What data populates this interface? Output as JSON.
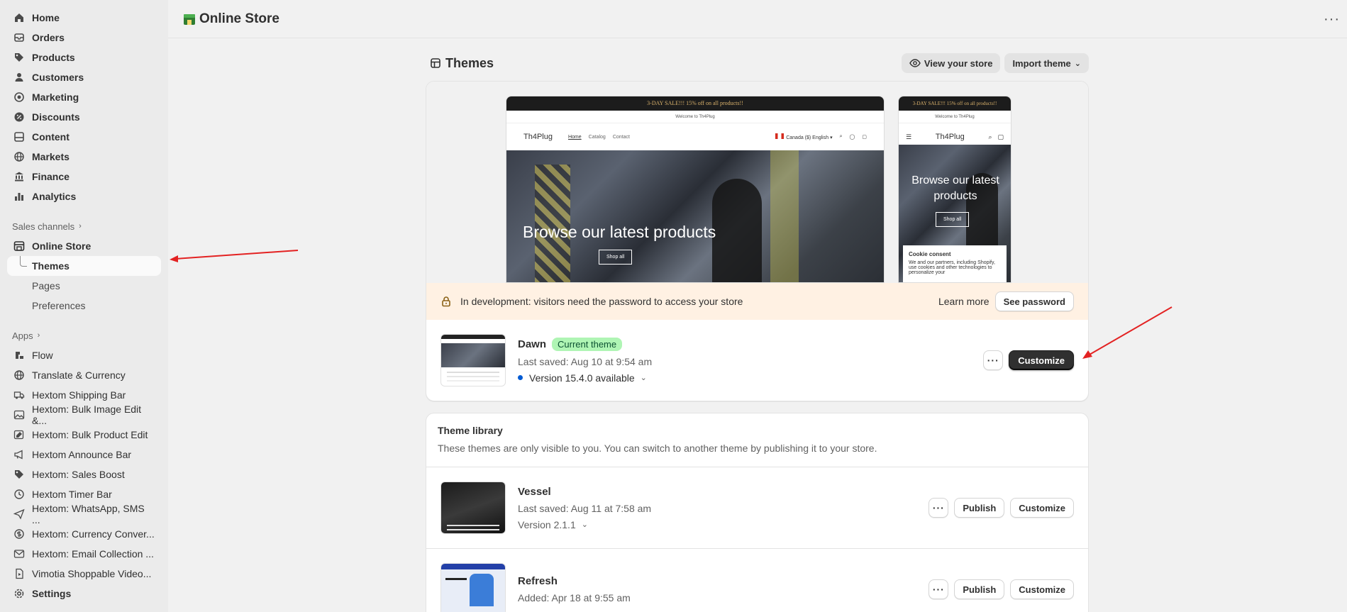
{
  "sidebar": {
    "main_items": [
      {
        "label": "Home",
        "icon": "home-icon"
      },
      {
        "label": "Orders",
        "icon": "orders-icon"
      },
      {
        "label": "Products",
        "icon": "tag-icon"
      },
      {
        "label": "Customers",
        "icon": "person-icon"
      },
      {
        "label": "Marketing",
        "icon": "target-icon"
      },
      {
        "label": "Discounts",
        "icon": "discount-icon"
      },
      {
        "label": "Content",
        "icon": "content-icon"
      },
      {
        "label": "Markets",
        "icon": "globe-icon"
      },
      {
        "label": "Finance",
        "icon": "bank-icon"
      },
      {
        "label": "Analytics",
        "icon": "chart-icon"
      }
    ],
    "sales_channels_label": "Sales channels",
    "online_store_label": "Online Store",
    "online_store_sub": [
      "Themes",
      "Pages",
      "Preferences"
    ],
    "apps_label": "Apps",
    "apps": [
      {
        "label": "Flow",
        "icon": "flow-icon"
      },
      {
        "label": "Translate & Currency",
        "icon": "globe-icon"
      },
      {
        "label": "Hextom Shipping Bar",
        "icon": "truck-icon"
      },
      {
        "label": "Hextom: Bulk Image Edit &...",
        "icon": "image-icon"
      },
      {
        "label": "Hextom: Bulk Product Edit",
        "icon": "edit-icon"
      },
      {
        "label": "Hextom Announce Bar",
        "icon": "megaphone-icon"
      },
      {
        "label": "Hextom: Sales Boost",
        "icon": "tag-icon"
      },
      {
        "label": "Hextom Timer Bar",
        "icon": "clock-icon"
      },
      {
        "label": "Hextom: WhatsApp, SMS ...",
        "icon": "send-icon"
      },
      {
        "label": "Hextom: Currency Conver...",
        "icon": "currency-icon"
      },
      {
        "label": "Hextom: Email Collection ...",
        "icon": "mail-icon"
      },
      {
        "label": "Vimotia Shoppable Video...",
        "icon": "video-icon"
      }
    ],
    "settings_label": "Settings"
  },
  "topbar": {
    "title": "Online Store",
    "more": "···"
  },
  "page": {
    "title": "Themes",
    "view_store": "View your store",
    "import_theme": "Import theme"
  },
  "preview": {
    "announcement": "3-DAY SALE!!! 15% off on all products!!",
    "welcome": "Welcome to Th4Plug",
    "logo": "Th4Plug",
    "nav_links": [
      "Home",
      "Catalog",
      "Contact"
    ],
    "locale": "Canada ($) English",
    "hero_title": "Browse our latest products",
    "hero_button": "Shop all",
    "cookie_title": "Cookie consent",
    "cookie_text": "We and our partners, including Shopify, use cookies and other technologies to personalize your"
  },
  "dev_banner": {
    "text": "In development: visitors need the password to access your store",
    "learn_more": "Learn more",
    "see_password": "See password"
  },
  "current_theme": {
    "name": "Dawn",
    "badge": "Current theme",
    "saved": "Last saved: Aug 10 at 9:54 am",
    "version": "Version 15.4.0 available",
    "more": "···",
    "customize": "Customize"
  },
  "library": {
    "title": "Theme library",
    "description": "These themes are only visible to you. You can switch to another theme by publishing it to your store.",
    "themes": [
      {
        "name": "Vessel",
        "meta": "Last saved: Aug 11 at 7:58 am",
        "version": "Version 2.1.1",
        "publish": "Publish",
        "customize": "Customize",
        "more": "···"
      },
      {
        "name": "Refresh",
        "meta": "Added: Apr 18 at 9:55 am",
        "version": "",
        "publish": "Publish",
        "customize": "Customize",
        "more": "···"
      }
    ]
  },
  "colors": {
    "sidebar_bg": "#ebebeb",
    "page_bg": "#f1f1f1",
    "banner_bg": "#fff1e3",
    "badge_bg": "#aff5b4",
    "arrow": "#e32222"
  }
}
